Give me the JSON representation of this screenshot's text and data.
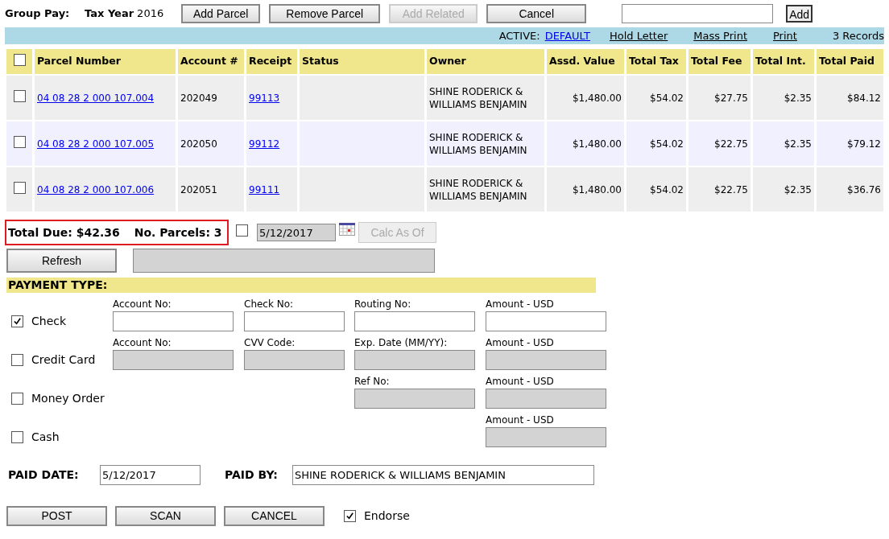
{
  "header": {
    "title": "Group Pay:",
    "tax_year_label": "Tax Year",
    "tax_year": "2016",
    "buttons": [
      {
        "label": "Add Parcel",
        "disabled": false
      },
      {
        "label": "Remove Parcel",
        "disabled": false
      },
      {
        "label": "Add Related",
        "disabled": true
      },
      {
        "label": "Cancel",
        "disabled": false
      }
    ],
    "search_button": "Add"
  },
  "toolbar": {
    "active_label": "ACTIVE:",
    "active_link": "DEFAULT",
    "links": [
      "Hold Letter",
      "Mass Print",
      "Print"
    ],
    "records": "3 Records"
  },
  "table": {
    "select_all": {
      "checked": false
    },
    "columns": [
      "Parcel Number",
      "Account #",
      "Receipt",
      "Status",
      "Owner",
      "Assd. Value",
      "Total Tax",
      "Total Fee",
      "Total Int.",
      "Total Paid"
    ],
    "rows": [
      {
        "checked": false,
        "parcel": "04 08 28 2 000 107.004",
        "account": "202049",
        "receipt": "99113",
        "status": "",
        "owner": "SHINE RODERICK & WILLIAMS BENJAMIN",
        "assd_value": "$1,480.00",
        "total_tax": "$54.02",
        "total_fee": "$27.75",
        "total_int": "$2.35",
        "total_paid": "$84.12"
      },
      {
        "checked": false,
        "parcel": "04 08 28 2 000 107.005",
        "account": "202050",
        "receipt": "99112",
        "status": "",
        "owner": "SHINE RODERICK & WILLIAMS BENJAMIN",
        "assd_value": "$1,480.00",
        "total_tax": "$54.02",
        "total_fee": "$22.75",
        "total_int": "$2.35",
        "total_paid": "$79.12"
      },
      {
        "checked": false,
        "parcel": "04 08 28 2 000 107.006",
        "account": "202051",
        "receipt": "99111",
        "status": "",
        "owner": "SHINE RODERICK & WILLIAMS BENJAMIN",
        "assd_value": "$1,480.00",
        "total_tax": "$54.02",
        "total_fee": "$22.75",
        "total_int": "$2.35",
        "total_paid": "$36.76"
      }
    ]
  },
  "summary": {
    "total_due": "Total Due: $42.36",
    "parcels": "No. Parcels: 3",
    "calc_checked": false,
    "calc_date": "5/12/2017",
    "calc_button": "Calc As Of",
    "refresh_button": "Refresh"
  },
  "payment": {
    "heading": "PAYMENT TYPE:",
    "types": [
      {
        "label": "Check",
        "checked": true,
        "fields": [
          {
            "kind": "account",
            "label": "Account No:",
            "disabled": false
          },
          {
            "kind": "code",
            "label": "Check No:",
            "disabled": false
          },
          {
            "kind": "reference",
            "label": "Routing No:",
            "disabled": false
          },
          {
            "kind": "amount",
            "label": "Amount - USD",
            "disabled": false
          }
        ]
      },
      {
        "label": "Credit Card",
        "checked": false,
        "fields": [
          {
            "kind": "account",
            "label": "Account No:",
            "disabled": true
          },
          {
            "kind": "code",
            "label": "CVV Code:",
            "disabled": true
          },
          {
            "kind": "reference",
            "label": "Exp. Date (MM/YY):",
            "disabled": true
          },
          {
            "kind": "amount",
            "label": "Amount - USD",
            "disabled": true
          }
        ]
      },
      {
        "label": "Money Order",
        "checked": false,
        "fields": [
          {
            "kind": "reference",
            "label": "Ref No:",
            "disabled": true
          },
          {
            "kind": "amount",
            "label": "Amount - USD",
            "disabled": true
          }
        ]
      },
      {
        "label": "Cash",
        "checked": false,
        "fields": [
          {
            "kind": "amount",
            "label": "Amount - USD",
            "disabled": true
          }
        ]
      }
    ]
  },
  "paid": {
    "date_label": "PAID DATE:",
    "date": "5/12/2017",
    "by_label": "PAID BY:",
    "by": "SHINE RODERICK & WILLIAMS BENJAMIN"
  },
  "actions": {
    "buttons": [
      "POST",
      "SCAN",
      "CANCEL"
    ],
    "endorse_label": "Endorse",
    "endorse_checked": true
  }
}
